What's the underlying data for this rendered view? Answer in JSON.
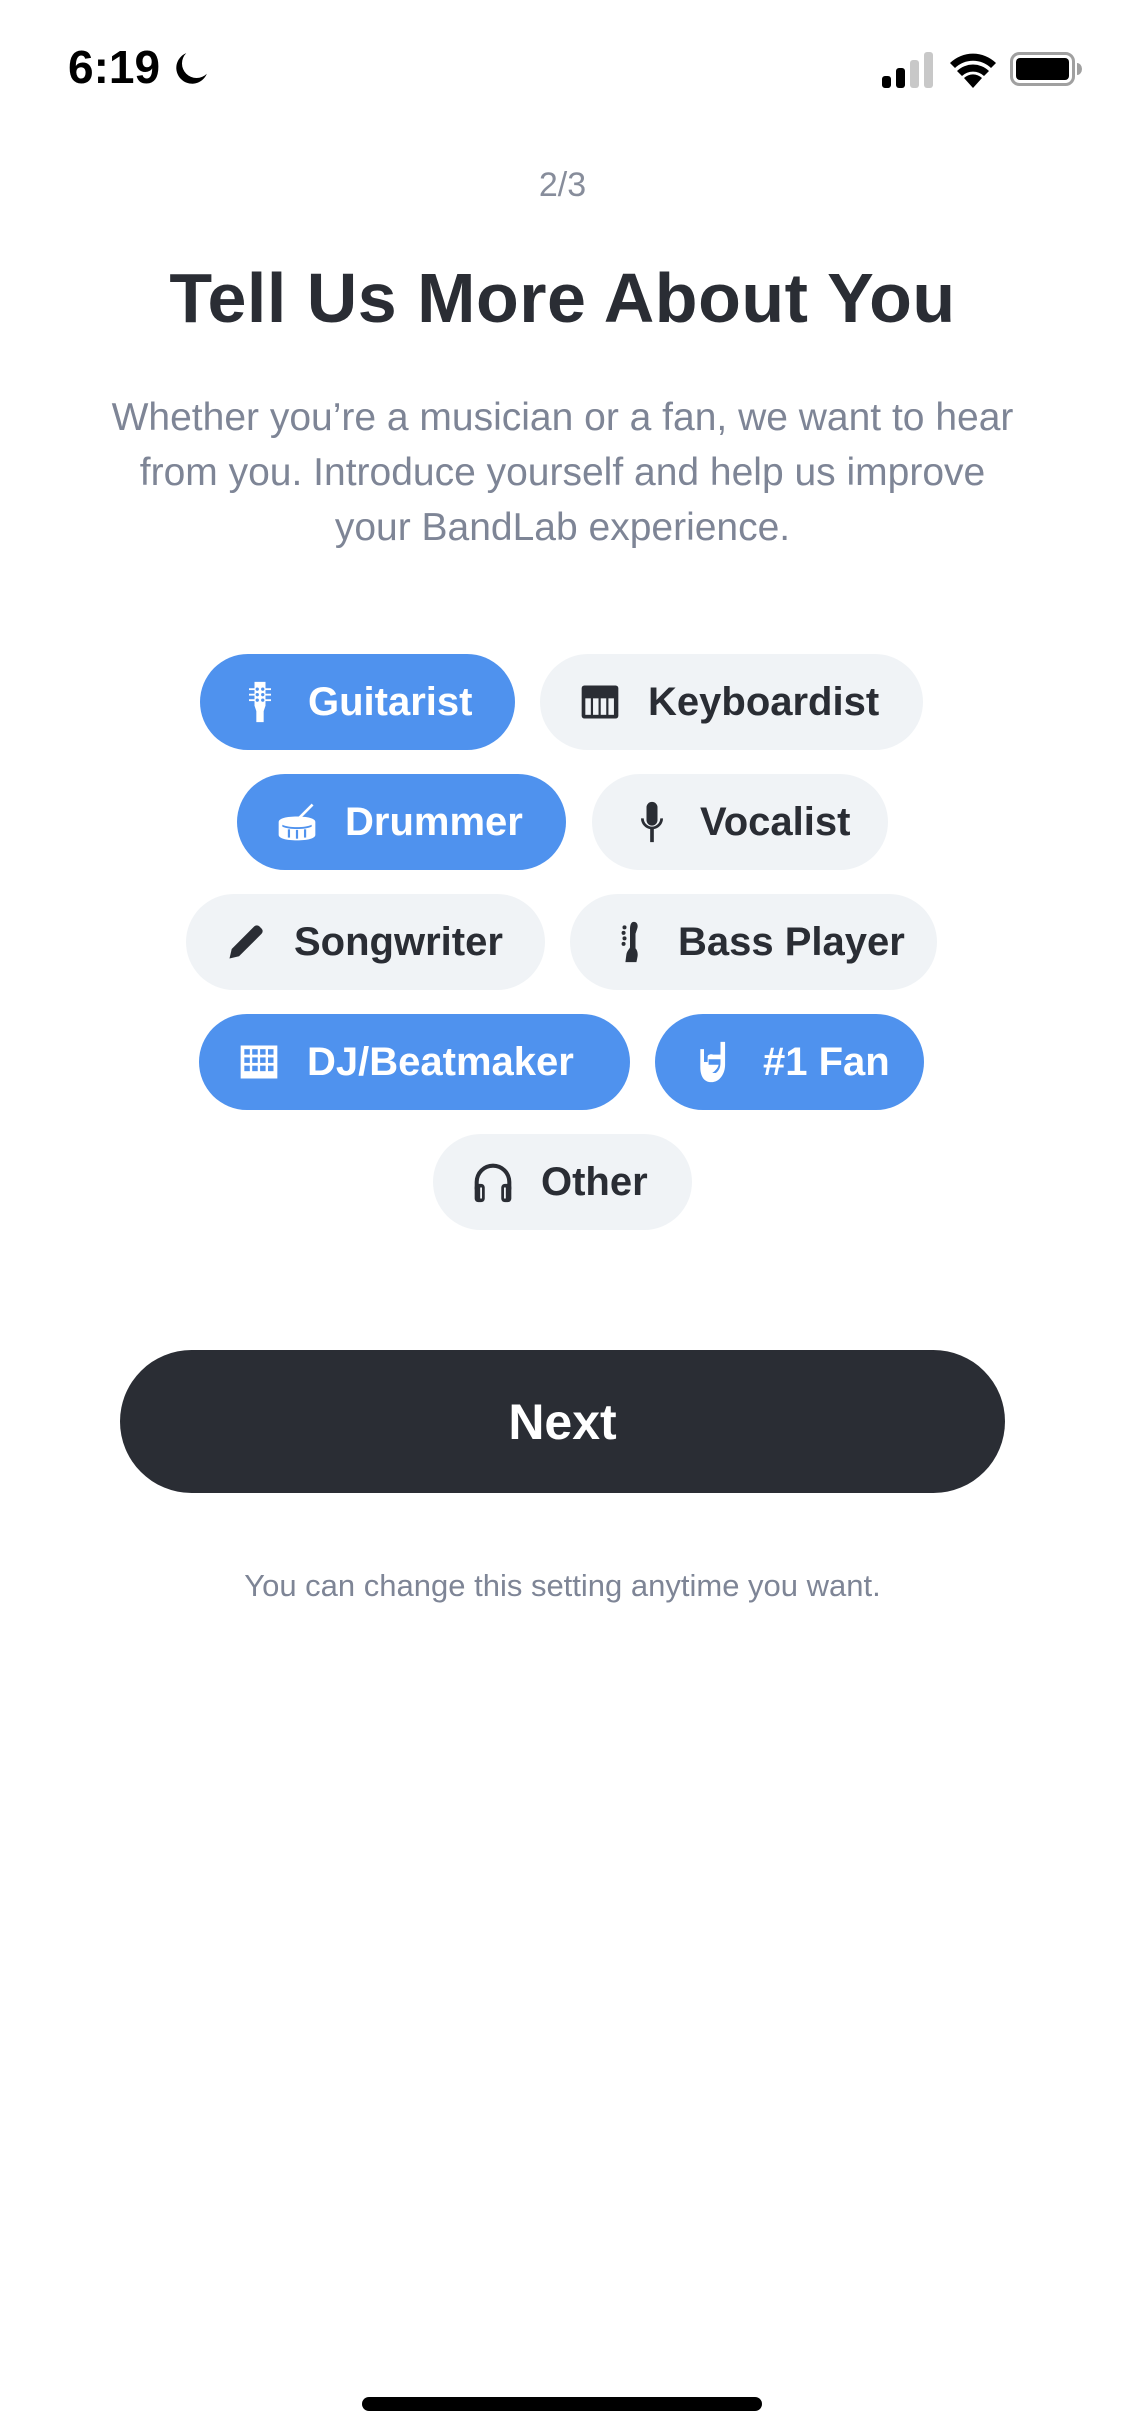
{
  "status_bar": {
    "time": "6:19",
    "focus_icon": "moon-icon",
    "signal_bars_filled": 2,
    "signal_bars_total": 4,
    "wifi_icon": "wifi-icon",
    "battery_icon": "battery-icon",
    "battery_level_pct": 90
  },
  "header": {
    "step": "2/3",
    "title": "Tell Us More About You",
    "subtitle": "Whether you’re a musician or a fan, we want to hear from you. Introduce yourself and help us improve your BandLab experience."
  },
  "colors": {
    "selected_chip": "#4F92EE",
    "unselected_chip": "#F0F3F6",
    "primary_dark": "#2A2D34",
    "muted_text": "#7E8596"
  },
  "roles": [
    {
      "label": "Guitarist",
      "icon": "guitar-icon",
      "selected": true
    },
    {
      "label": "Keyboardist",
      "icon": "piano-keys-icon",
      "selected": false
    },
    {
      "label": "Drummer",
      "icon": "drum-icon",
      "selected": true
    },
    {
      "label": "Vocalist",
      "icon": "microphone-icon",
      "selected": false
    },
    {
      "label": "Songwriter",
      "icon": "pencil-icon",
      "selected": false
    },
    {
      "label": "Bass Player",
      "icon": "bass-guitar-icon",
      "selected": false
    },
    {
      "label": "DJ/Beatmaker",
      "icon": "beat-pad-icon",
      "selected": true
    },
    {
      "label": "#1 Fan",
      "icon": "rock-hand-icon",
      "selected": true
    },
    {
      "label": "Other",
      "icon": "headphones-icon",
      "selected": false
    }
  ],
  "actions": {
    "next_label": "Next",
    "footnote": "You can change this setting anytime you want."
  }
}
